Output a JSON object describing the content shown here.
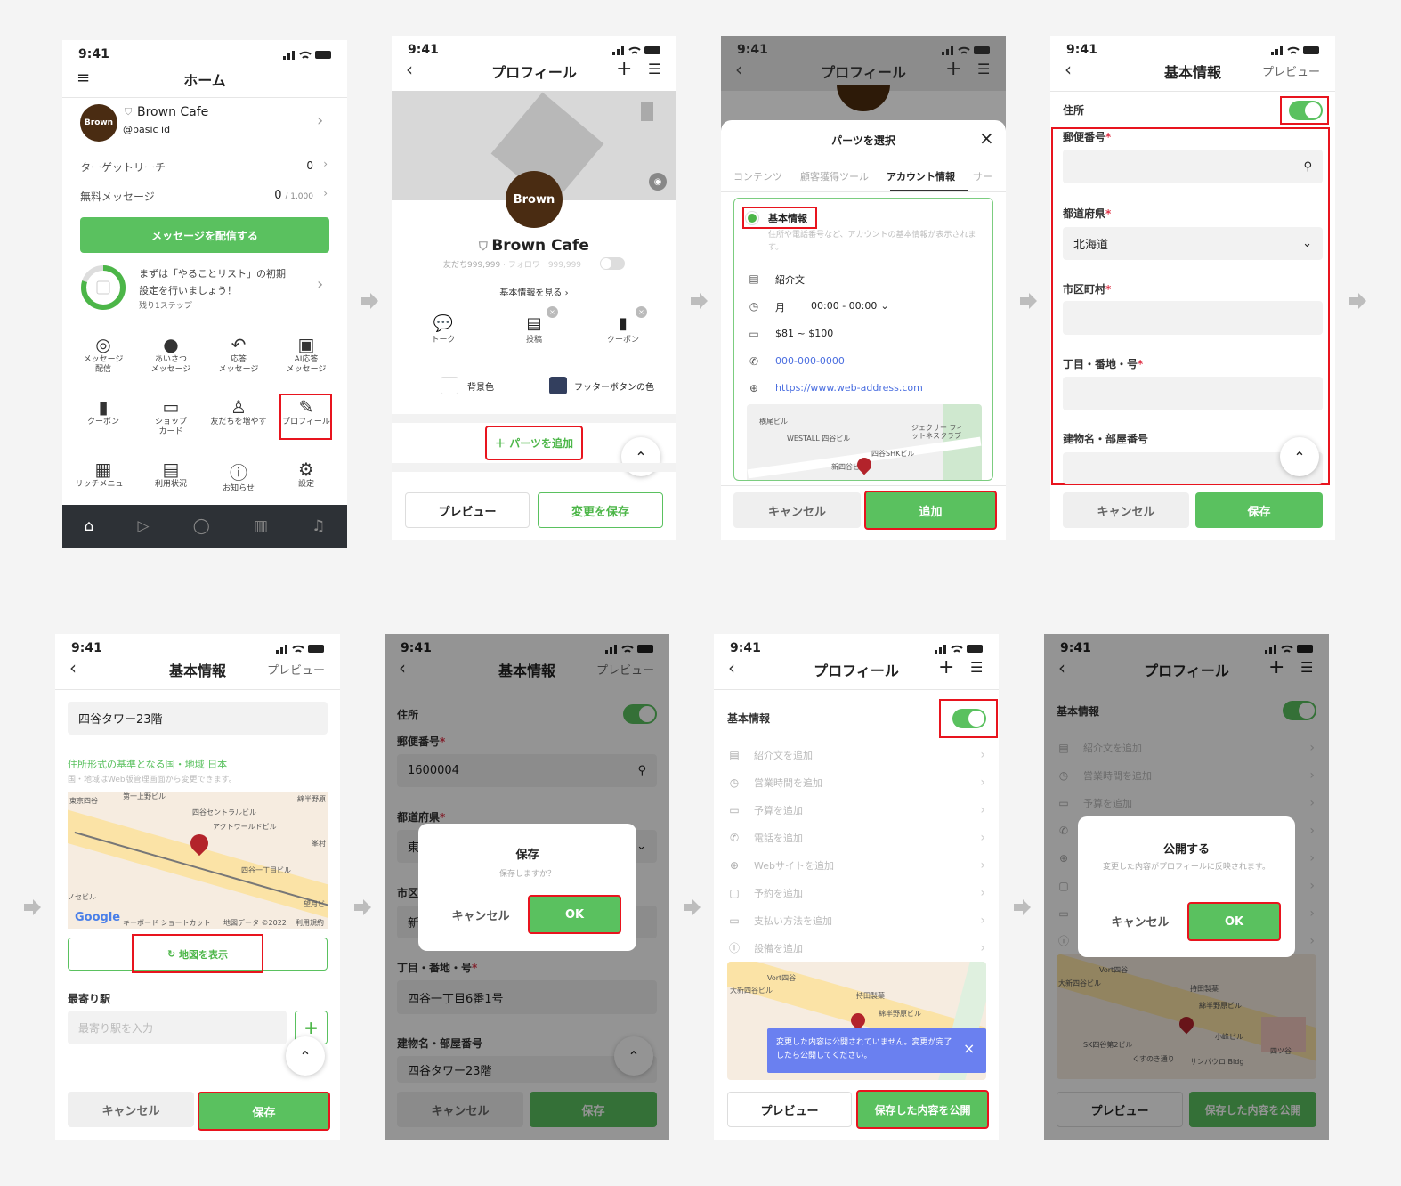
{
  "status_time": "9:41",
  "home": {
    "title": "ホーム",
    "avatar_text": "Brown",
    "account_name": "Brown Cafe",
    "account_id": "@basic id",
    "target_reach_label": "ターゲットリーチ",
    "target_reach_value": "0",
    "free_message_label": "無料メッセージ",
    "free_message_value": "0",
    "free_message_limit": "/ 1,000",
    "send_button": "メッセージを配信する",
    "todo_line1": "まずは「やることリスト」の初期",
    "todo_line2": "設定を行いましょう！",
    "todo_remaining": "残り1ステップ",
    "todo_progress": 0.8,
    "grid": [
      {
        "label": "メッセージ\n配信",
        "icon": "broadcast-icon"
      },
      {
        "label": "あいさつ\nメッセージ",
        "icon": "greeting-icon"
      },
      {
        "label": "応答\nメッセージ",
        "icon": "reply-icon"
      },
      {
        "label": "AI応答\nメッセージ",
        "icon": "robot-icon"
      },
      {
        "label": "クーポン",
        "icon": "coupon-icon"
      },
      {
        "label": "ショップ\nカード",
        "icon": "shop-card-icon"
      },
      {
        "label": "友だちを増やす",
        "icon": "add-friend-icon"
      },
      {
        "label": "プロフィール",
        "icon": "profile-edit-icon"
      },
      {
        "label": "リッチメニュー",
        "icon": "rich-menu-icon"
      },
      {
        "label": "利用状況",
        "icon": "usage-icon"
      },
      {
        "label": "お知らせ",
        "icon": "info-icon"
      },
      {
        "label": "設定",
        "icon": "gear-icon"
      }
    ],
    "tabbar": [
      "home-icon",
      "play-icon",
      "chat-icon",
      "chart-icon",
      "bell-icon"
    ]
  },
  "profile": {
    "title": "プロフィール",
    "avatar_text": "Brown",
    "name": "Brown Cafe",
    "friends": "友だち999,999",
    "followers": "フォロワー999,999",
    "view_basic_info": "基本情報を見る ›",
    "parts": [
      "トーク",
      "投稿",
      "クーポン"
    ],
    "background_color_label": "背景色",
    "footer_button_color_label": "フッターボタンの色",
    "footer_button_color": "#333f5e",
    "add_parts": "＋ パーツを追加",
    "preview": "プレビュー",
    "save_changes": "変更を保存"
  },
  "parts_select": {
    "header_title": "プロフィール",
    "sheet_title": "パーツを選択",
    "tabs": [
      "コンテンツ",
      "顧客獲得ツール",
      "アカウント情報",
      "サー"
    ],
    "active_tab": 2,
    "option_title": "基本情報",
    "option_desc": "住所や電話番号など、アカウントの基本情報が表示されます。",
    "intro": "紹介文",
    "day": "月",
    "hours": "00:00 - 00:00",
    "budget": "$81 ~ $100",
    "phone": "000-000-0000",
    "website": "https://www.web-address.com",
    "map_labels": [
      "横尾ビル",
      "WESTALL 四谷ビル",
      "ジェクサー フィットネスクラブ",
      "四谷SHKビル",
      "新四谷ビル"
    ],
    "cancel": "キャンセル",
    "add": "追加"
  },
  "basic_form": {
    "title": "基本情報",
    "preview": "プレビュー",
    "address_label": "住所",
    "postal_label": "郵便番号",
    "prefecture_label": "都道府県",
    "prefecture_value": "北海道",
    "city_label": "市区町村",
    "street_label": "丁目・番地・号",
    "building_label": "建物名・部屋番号",
    "required_mark": "*",
    "cancel": "キャンセル",
    "save": "保存"
  },
  "basic_map": {
    "title": "基本情報",
    "preview": "プレビュー",
    "building_value": "四谷タワー23階",
    "country_note": "住所形式の基準となる国・地域 日本",
    "country_sub": "国・地域はWeb版管理画面から変更できます。",
    "map_labels": [
      "東京四谷",
      "第一上野ビル",
      "四谷セントラルビル",
      "アクトワールドビル",
      "四谷一丁目ビル",
      "綿半野原",
      "峯村",
      "望月ビ",
      "ノセビル"
    ],
    "map_footer": [
      "Google",
      "キーボード ショートカット",
      "地図データ ©2022",
      "利用規約"
    ],
    "show_map": "地図を表示",
    "nearest_station_label": "最寄り駅",
    "nearest_station_placeholder": "最寄り駅を入力",
    "cancel": "キャンセル",
    "save": "保存"
  },
  "save_dialog_screen": {
    "title": "基本情報",
    "preview": "プレビュー",
    "address_label": "住所",
    "postal_label": "郵便番号",
    "postal_value": "1600004",
    "prefecture_label": "都道府県",
    "prefecture_value": "東",
    "city_label": "市区",
    "city_value": "新",
    "street_label": "丁目・番地・号",
    "street_value": "四谷一丁目6番1号",
    "building_label": "建物名・部屋番号",
    "building_value": "四谷タワー23階",
    "dialog_title": "保存",
    "dialog_message": "保存しますか？",
    "dialog_cancel": "キャンセル",
    "dialog_ok": "OK",
    "cancel": "キャンセル",
    "save": "保存"
  },
  "profile_published": {
    "title": "プロフィール",
    "section": "基本情報",
    "rows": [
      {
        "label": "紹介文を追加",
        "icon": "document-icon"
      },
      {
        "label": "営業時間を追加",
        "icon": "clock-icon"
      },
      {
        "label": "予算を追加",
        "icon": "wallet-icon"
      },
      {
        "label": "電話を追加",
        "icon": "phone-icon"
      },
      {
        "label": "Webサイトを追加",
        "icon": "globe-icon"
      },
      {
        "label": "予約を追加",
        "icon": "calendar-icon"
      },
      {
        "label": "支払い方法を追加",
        "icon": "card-icon"
      },
      {
        "label": "設備を追加",
        "icon": "alert-icon"
      }
    ],
    "map_labels": [
      "Vort四谷",
      "大新四谷ビル",
      "持田製薬",
      "綿半野原ビル"
    ],
    "toast": "変更した内容は公開されていません。変更が完了したら公開してください。",
    "toast_color": "#6a80f0",
    "preview": "プレビュー",
    "publish": "保存した内容を公開"
  },
  "publish_dialog_screen": {
    "title": "プロフィール",
    "section": "基本情報",
    "rows": [
      "紹介文を追加",
      "営業時間を追加",
      "予算を追加"
    ],
    "map_labels": [
      "Vort四谷",
      "大新四谷ビル",
      "持田製薬",
      "綿半野原ビル",
      "小峰ビル",
      "SK四谷第2ビル",
      "くすのき通り",
      "サンパウロ Bldg",
      "四ツ谷"
    ],
    "dialog_title": "公開する",
    "dialog_message": "変更した内容がプロフィールに反映されます。",
    "dialog_cancel": "キャンセル",
    "dialog_ok": "OK",
    "preview": "プレビュー",
    "publish": "保存した内容を公開"
  },
  "colors": {
    "accent_green": "#5ac15f",
    "highlight_red": "#e8141e",
    "brand_brown": "#4a2c12"
  }
}
